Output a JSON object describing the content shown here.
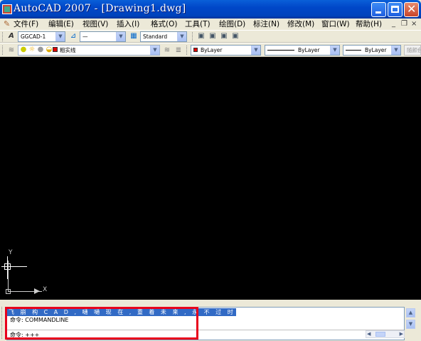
{
  "window": {
    "title": "AutoCAD 2007 - [Drawing1.dwg]",
    "minimize_glyph": "",
    "maximize_glyph": "",
    "close_glyph": "✕"
  },
  "menubar": {
    "items": [
      "文件(F)",
      "编辑(E)",
      "视图(V)",
      "插入(I)",
      "格式(O)",
      "工具(T)",
      "绘图(D)",
      "标注(N)",
      "修改(M)",
      "窗口(W)",
      "帮助(H)"
    ],
    "mdi_min": "_",
    "mdi_restore": "❐",
    "mdi_close": "×"
  },
  "toolbar_styles": {
    "text_style": "GGCAD-1",
    "dim_style": "—",
    "table_style": "Standard"
  },
  "toolbar_layers": {
    "current_layer": "粗实线",
    "color": "ByLayer",
    "linetype": "ByLayer",
    "lineweight": "ByLayer",
    "plotstyle": "随颜色",
    "layer_color_swatch": "#e00000"
  },
  "canvas": {
    "background": "#000000",
    "ucs_x_label": "X",
    "ucs_y_label": "Y"
  },
  "command": {
    "history_line": "飞 崩 构 C A D , 嗵 嗵 现 在 , 重 着 未 来 , 永 不 过 时",
    "prev_command": "命令: COMMANDLINE",
    "prompt": "命令: +++",
    "highlight_color": "#316ac5",
    "annotation_box_color": "#e8001c"
  }
}
